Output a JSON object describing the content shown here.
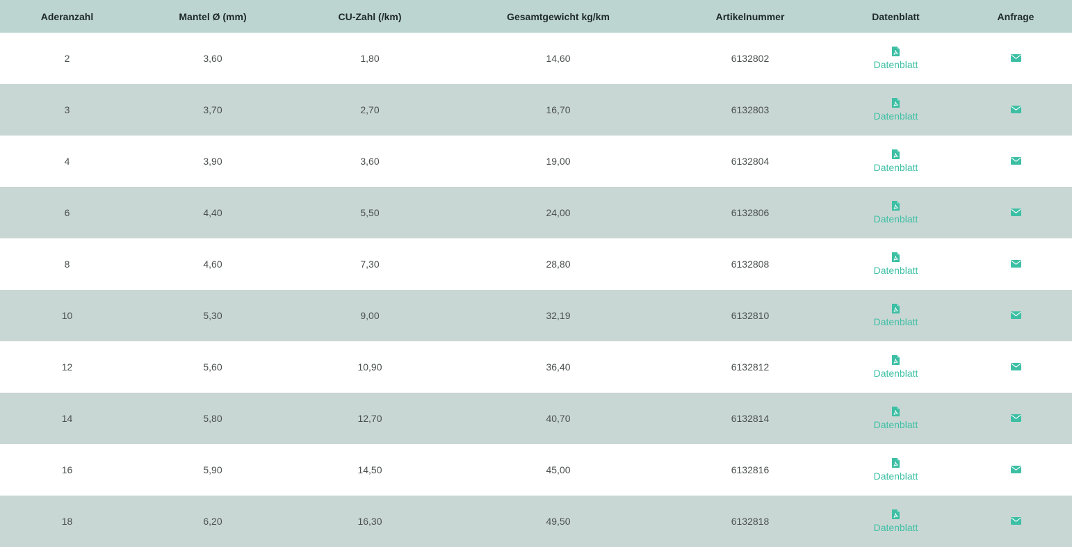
{
  "colors": {
    "header_bg": "#bdd5d1",
    "stripe_bg": "#c9d7d4",
    "accent": "#3dbfa4"
  },
  "table": {
    "headers": [
      "Aderanzahl",
      "Mantel Ø (mm)",
      "CU-Zahl (/km)",
      "Gesamtgewicht kg/km",
      "Artikelnummer",
      "Datenblatt",
      "Anfrage"
    ],
    "datasheet_label": "Datenblatt",
    "icons": {
      "datasheet": "pdf-file-icon",
      "inquiry": "envelope-icon"
    },
    "rows": [
      {
        "aderanzahl": "2",
        "mantel": "3,60",
        "cu": "1,80",
        "gewicht": "14,60",
        "artikel": "6132802"
      },
      {
        "aderanzahl": "3",
        "mantel": "3,70",
        "cu": "2,70",
        "gewicht": "16,70",
        "artikel": "6132803"
      },
      {
        "aderanzahl": "4",
        "mantel": "3,90",
        "cu": "3,60",
        "gewicht": "19,00",
        "artikel": "6132804"
      },
      {
        "aderanzahl": "6",
        "mantel": "4,40",
        "cu": "5,50",
        "gewicht": "24,00",
        "artikel": "6132806"
      },
      {
        "aderanzahl": "8",
        "mantel": "4,60",
        "cu": "7,30",
        "gewicht": "28,80",
        "artikel": "6132808"
      },
      {
        "aderanzahl": "10",
        "mantel": "5,30",
        "cu": "9,00",
        "gewicht": "32,19",
        "artikel": "6132810"
      },
      {
        "aderanzahl": "12",
        "mantel": "5,60",
        "cu": "10,90",
        "gewicht": "36,40",
        "artikel": "6132812"
      },
      {
        "aderanzahl": "14",
        "mantel": "5,80",
        "cu": "12,70",
        "gewicht": "40,70",
        "artikel": "6132814"
      },
      {
        "aderanzahl": "16",
        "mantel": "5,90",
        "cu": "14,50",
        "gewicht": "45,00",
        "artikel": "6132816"
      },
      {
        "aderanzahl": "18",
        "mantel": "6,20",
        "cu": "16,30",
        "gewicht": "49,50",
        "artikel": "6132818"
      }
    ]
  }
}
